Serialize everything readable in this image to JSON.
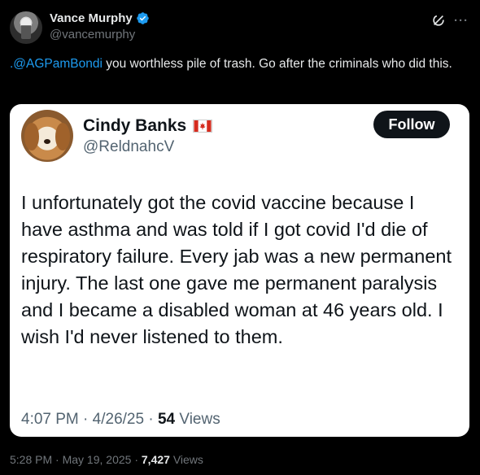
{
  "author": {
    "display_name": "Vance Murphy",
    "handle": "@vancemurphy",
    "verified_color": "#1d9bf0"
  },
  "tweet": {
    "mention": ".@AGPamBondi",
    "text": " you worthless pile of trash. Go after the criminals who did this."
  },
  "quote": {
    "display_name": "Cindy Banks",
    "flag": "canada-flag-icon",
    "handle": "@ReldnahcV",
    "follow_label": "Follow",
    "text": "I unfortunately got the covid vaccine because I have asthma and was told if I got covid I'd die of respiratory failure. Every jab was a new permanent injury. The last one gave me permanent paralysis and I became a disabled woman at 46 years old. I wish I'd never listened to them.",
    "time": "4:07 PM",
    "date": "4/26/25",
    "views_count": "54",
    "views_label": "Views"
  },
  "footer": {
    "time": "5:28 PM",
    "date": "May 19, 2025",
    "views_count": "7,427",
    "views_label": "Views"
  },
  "colors": {
    "background": "#000000",
    "link": "#1d9bf0",
    "card_bg": "#ffffff"
  }
}
